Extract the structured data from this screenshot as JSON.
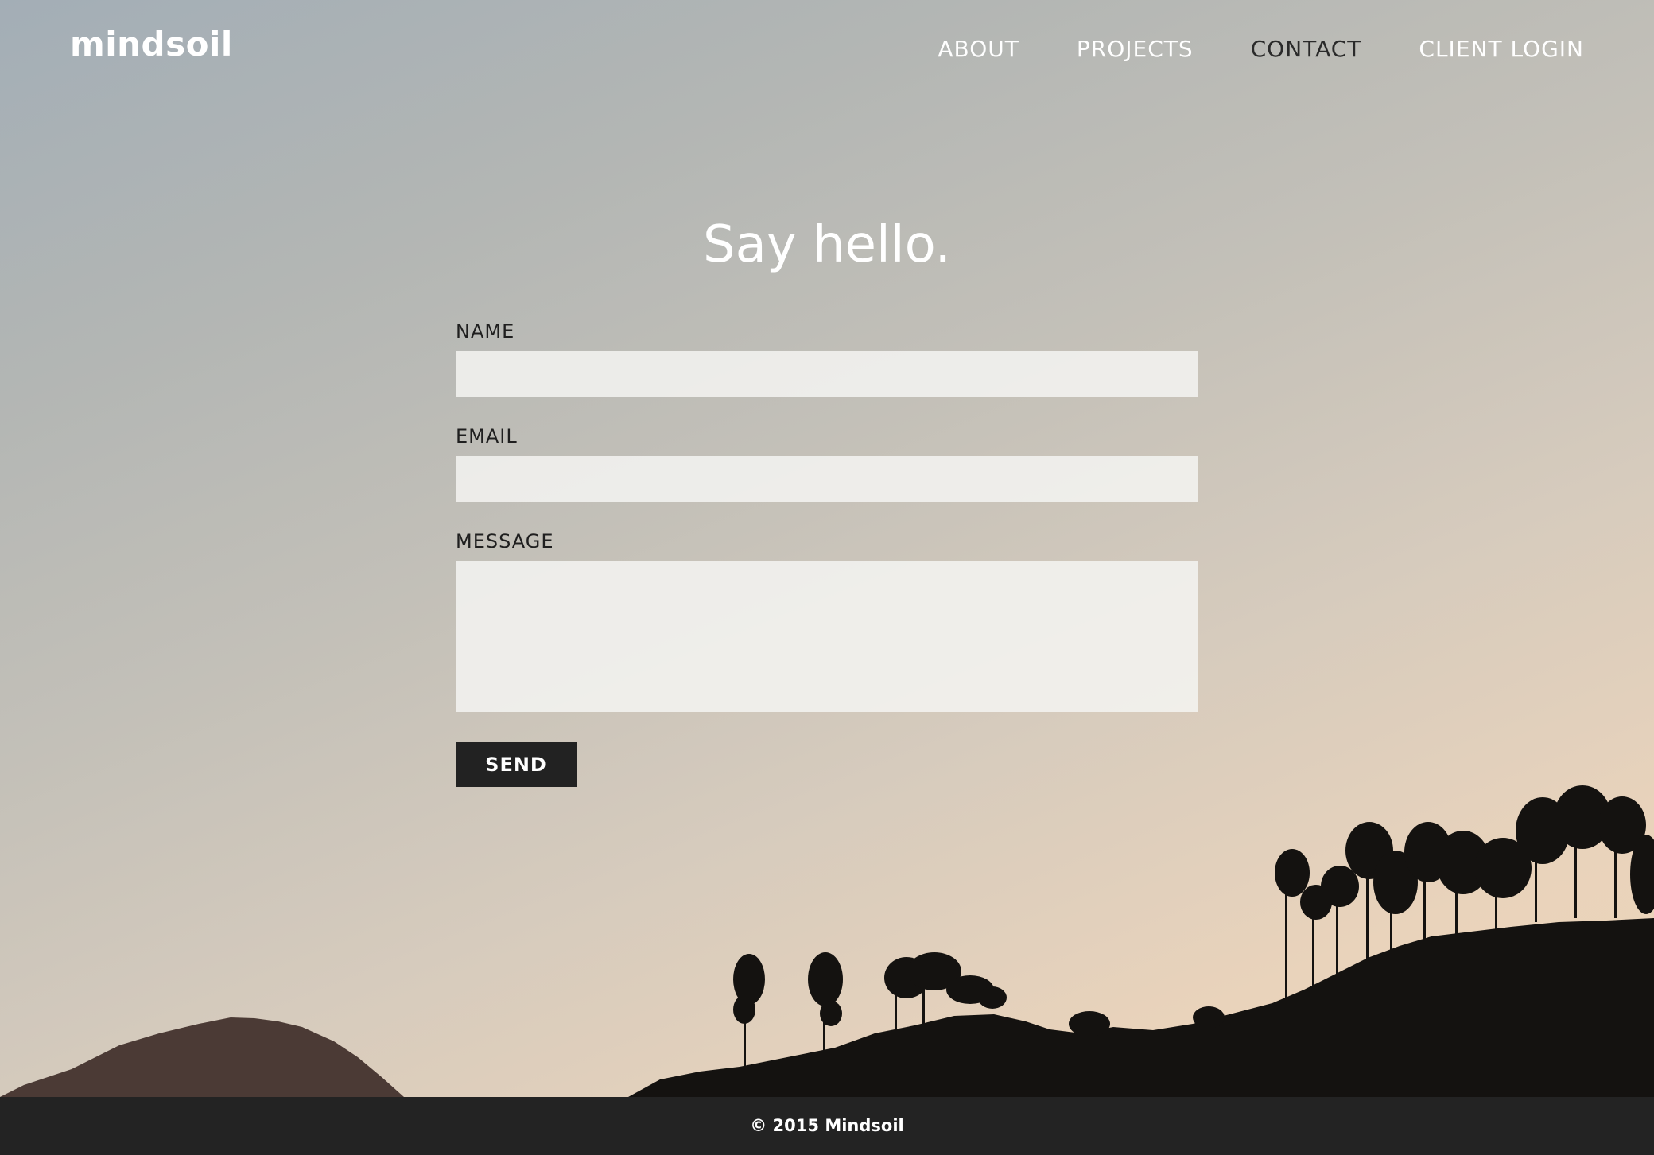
{
  "header": {
    "logo": "mindsoil",
    "nav": [
      {
        "label": "ABOUT"
      },
      {
        "label": "PROJECTS"
      },
      {
        "label": "CONTACT"
      },
      {
        "label": "CLIENT LOGIN"
      }
    ],
    "active_nav": "CONTACT"
  },
  "main": {
    "title": "Say hello.",
    "form": {
      "name_label": "NAME",
      "name_value": "",
      "email_label": "EMAIL",
      "email_value": "",
      "message_label": "MESSAGE",
      "message_value": "",
      "send_label": "SEND"
    }
  },
  "footer": {
    "text": "© 2015 Mindsoil"
  },
  "colors": {
    "footer_bg": "#232323",
    "button_bg": "#222222",
    "input_bg": "#f3f2f0"
  }
}
